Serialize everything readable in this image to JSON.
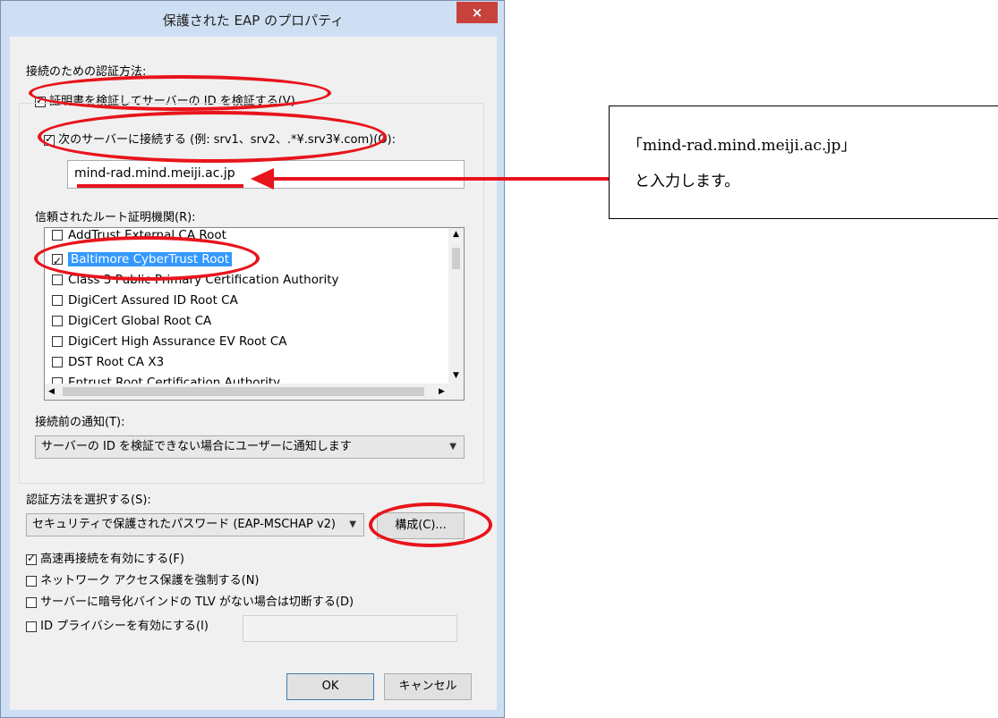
{
  "window": {
    "title": "保護された EAP のプロパティ",
    "close_glyph": "×"
  },
  "auth_section_label": "接続のための認証方法:",
  "verify_cert": {
    "label": "証明書を検証してサーバーの ID を検証する(V)",
    "checked": true
  },
  "connect_servers": {
    "label": "次のサーバーに接続する (例: srv1、srv2、.*¥.srv3¥.com)(O):",
    "checked": true
  },
  "server_field": {
    "value": "mind-rad.mind.meiji.ac.jp"
  },
  "trusted_ca_label": "信頼されたルート証明機関(R):",
  "trusted_ca_items": [
    {
      "label": "AddTrust External CA Root",
      "checked": false
    },
    {
      "label": "Baltimore CyberTrust Root",
      "checked": true,
      "selected": true
    },
    {
      "label": "Class 3 Public Primary Certification Authority",
      "checked": false
    },
    {
      "label": "DigiCert Assured ID Root CA",
      "checked": false
    },
    {
      "label": "DigiCert Global Root CA",
      "checked": false
    },
    {
      "label": "DigiCert High Assurance EV Root CA",
      "checked": false
    },
    {
      "label": "DST Root CA X3",
      "checked": false
    },
    {
      "label": "Entrust Root Certification Authority",
      "checked": false
    }
  ],
  "notify_label": "接続前の通知(T):",
  "notify_select": {
    "value": "サーバーの ID を検証できない場合にユーザーに通知します"
  },
  "method_label": "認証方法を選択する(S):",
  "method_select": {
    "value": "セキュリティで保護されたパスワード (EAP-MSCHAP v2)"
  },
  "configure_button": "構成(C)...",
  "options": [
    {
      "label": "高速再接続を有効にする(F)",
      "checked": true
    },
    {
      "label": "ネットワーク アクセス保護を強制する(N)",
      "checked": false
    },
    {
      "label": "サーバーに暗号化バインドの TLV がない場合は切断する(D)",
      "checked": false
    },
    {
      "label": "ID プライバシーを有効にする(I)",
      "checked": false
    }
  ],
  "ok_button": "OK",
  "cancel_button": "キャンセル",
  "callout": {
    "line1": "「mind-rad.mind.meiji.ac.jp」",
    "line2": "と入力します。"
  },
  "annotation_color": "#e8141b"
}
